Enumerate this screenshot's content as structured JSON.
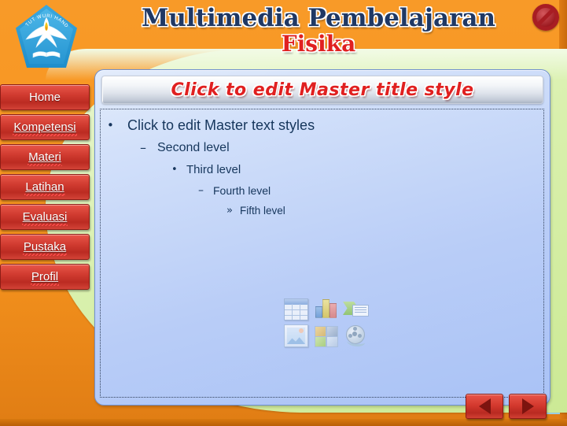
{
  "header": {
    "title_line1": "Multimedia Pembelajaran",
    "title_line2": "Fisika",
    "logo_name": "tut-wuri-handayani-logo",
    "logo_motto": "TUT WURI HANDAYANI",
    "exit_icon": "prohibited-icon",
    "colors": {
      "title_primary": "#1f3864",
      "title_accent": "#e02020",
      "background": "#f7951f"
    }
  },
  "sidebar": {
    "items": [
      {
        "label": "Home",
        "name": "sidebar-item-home",
        "misspelled": false
      },
      {
        "label": "Kompetensi",
        "name": "sidebar-item-kompetensi",
        "misspelled": true
      },
      {
        "label": "Materi",
        "name": "sidebar-item-materi",
        "misspelled": true
      },
      {
        "label": "Latihan",
        "name": "sidebar-item-latihan",
        "misspelled": true
      },
      {
        "label": "Evaluasi",
        "name": "sidebar-item-evaluasi",
        "misspelled": true
      },
      {
        "label": "Pustaka",
        "name": "sidebar-item-pustaka",
        "misspelled": true
      },
      {
        "label": "Profil",
        "name": "sidebar-item-profil",
        "misspelled": true
      }
    ],
    "button_color": "#cc3328"
  },
  "slide": {
    "title_placeholder": "Click to edit Master title style",
    "body_levels": [
      {
        "bullet": "•",
        "text": "Click to edit Master text styles"
      },
      {
        "bullet": "–",
        "text": "Second level"
      },
      {
        "bullet": "•",
        "text": "Third level"
      },
      {
        "bullet": "–",
        "text": "Fourth level"
      },
      {
        "bullet": "»",
        "text": "Fifth level"
      }
    ],
    "content_icons": [
      "table-icon",
      "chart-icon",
      "smartart-icon",
      "picture-icon",
      "clipart-icon",
      "media-clip-icon"
    ],
    "colors": {
      "panel_fill": "#b9cdf7",
      "panel_border": "#6e8fcf",
      "text": "#16365c"
    }
  },
  "navigation": {
    "back_label": "◀",
    "next_label": "▶",
    "back_name": "previous-slide-button",
    "next_name": "next-slide-button"
  }
}
